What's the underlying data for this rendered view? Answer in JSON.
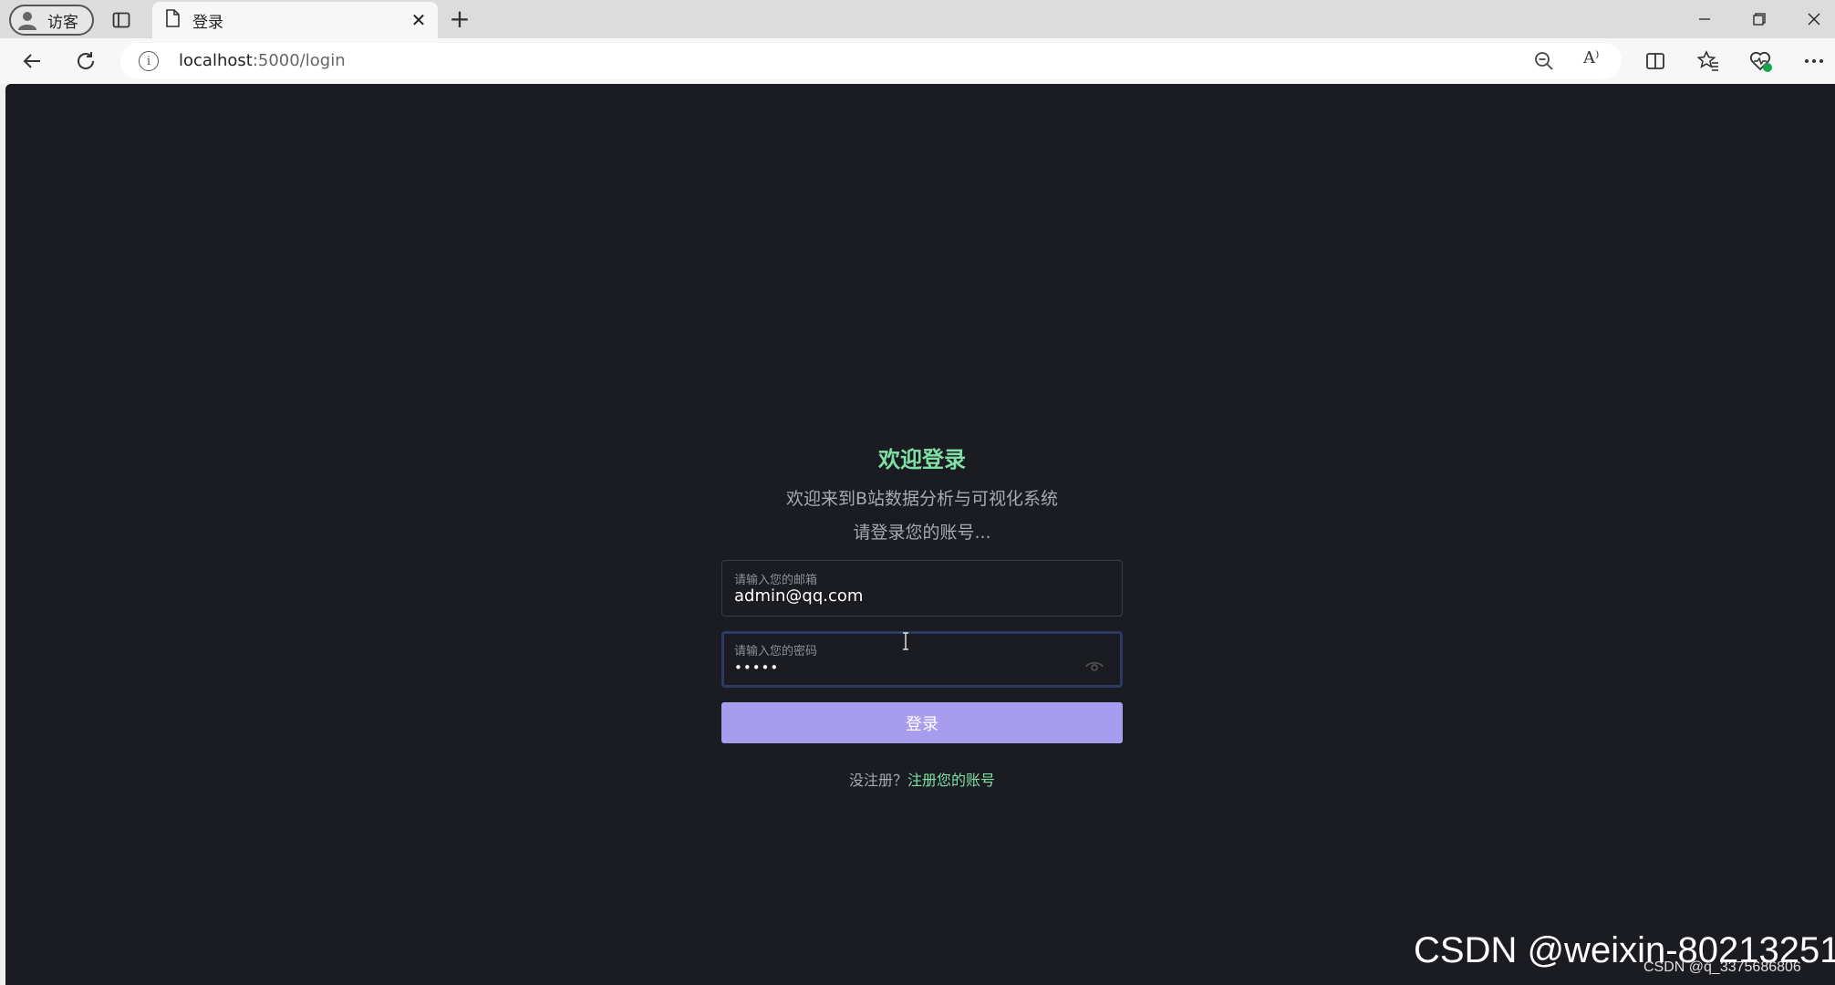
{
  "browser": {
    "profile_label": "访客",
    "tab_title": "登录",
    "url_host": "localhost",
    "url_path": ":5000/login",
    "read_aloud": "A⁾"
  },
  "login": {
    "welcome_title": "欢迎登录",
    "subtitle": "欢迎来到B站数据分析与可视化系统",
    "prompt": "请登录您的账号...",
    "email_label": "请输入您的邮箱",
    "email_value": "admin@qq.com",
    "password_label": "请输入您的密码",
    "password_value": "•••••",
    "login_button": "登录",
    "register_prompt": "没注册？",
    "register_link": "注册您的账号"
  },
  "watermark": {
    "main": "CSDN @weixin-80213251",
    "secondary": "CSDN @q_3375686806"
  },
  "colors": {
    "page_bg": "#1b1c21",
    "accent_green": "#7fe0a6",
    "button_purple": "#a89cee",
    "focus_border": "#2d3a63"
  }
}
